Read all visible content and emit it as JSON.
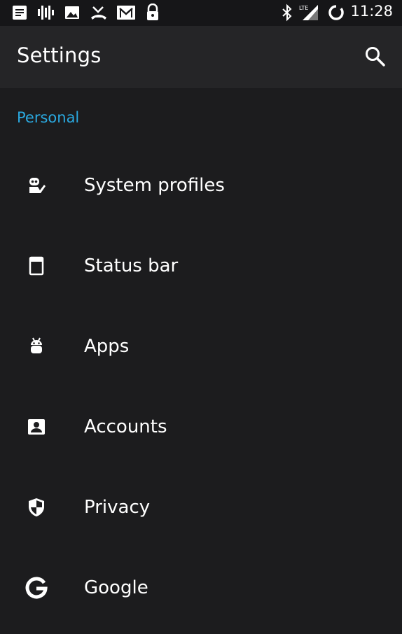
{
  "status_bar": {
    "left_icons": [
      "notes-icon",
      "voicemail-icon",
      "image-icon",
      "missed-call-icon",
      "gmail-icon",
      "lock-icon"
    ],
    "right_icons": [
      "bluetooth-icon",
      "signal-lte-icon",
      "battery-ring-icon"
    ],
    "network_label": "LTE",
    "time": "11:28"
  },
  "app_bar": {
    "title": "Settings",
    "search_icon": "search-icon"
  },
  "section": {
    "title": "Personal"
  },
  "items": [
    {
      "label": "System profiles",
      "icon": "profiles-icon"
    },
    {
      "label": "Status bar",
      "icon": "status-bar-icon"
    },
    {
      "label": "Apps",
      "icon": "android-icon"
    },
    {
      "label": "Accounts",
      "icon": "account-box-icon"
    },
    {
      "label": "Privacy",
      "icon": "shield-icon"
    },
    {
      "label": "Google",
      "icon": "google-icon"
    }
  ],
  "colors": {
    "background": "#1c1c1e",
    "app_bar": "#252527",
    "status_bar": "#161618",
    "accent": "#2aa9e0",
    "text": "#ffffff"
  }
}
